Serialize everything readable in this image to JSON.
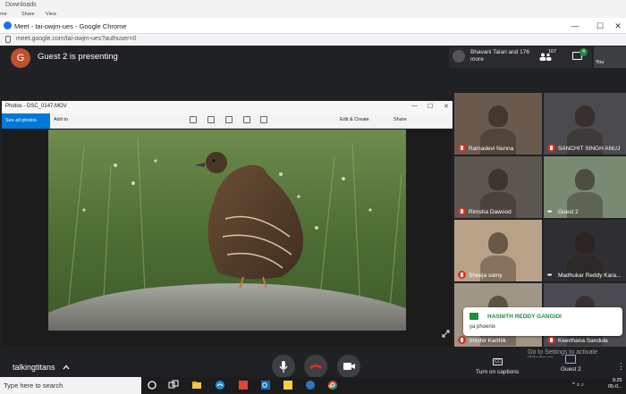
{
  "explorer": {
    "title": "Downloads",
    "menu": [
      "me",
      "Share",
      "View"
    ]
  },
  "browser": {
    "tab_title": "Meet - tai-owjm-ues - Google Chrome",
    "url": "meet.google.com/tai-owjm-ues?authuser=0",
    "win_buttons": [
      "—",
      "☐",
      "✕"
    ]
  },
  "meet": {
    "presenter_initial": "G",
    "presenting_text": "Guest 2 is presenting",
    "participants_summary": "Bhavani Talari and 176 more",
    "people_count": "107",
    "chat_badge": "4",
    "self_label": "You",
    "meeting_name": "talkingtitans",
    "captions_label": "Turn on captions",
    "presenter_label": "Guest 2",
    "activate_windows": "Go to Settings to activate Windows."
  },
  "photos": {
    "window_title": "Photos - DSC_0147.MOV",
    "see_all": "See all photos",
    "add_to": "Add to",
    "edit_create": "Edit & Create",
    "share": "Share",
    "title_buttons": [
      "—",
      "☐",
      "✕"
    ]
  },
  "tiles": [
    {
      "name": "Ramadevi Nunna",
      "status": "muted",
      "bg": "#6a5a4e"
    },
    {
      "name": "SANCHIT SINGH ANUJ",
      "status": "muted",
      "bg": "#4b4a4e"
    },
    {
      "name": "Rimsha Dawood",
      "status": "muted",
      "bg": "#5c5650"
    },
    {
      "name": "Guest 2",
      "status": "more",
      "bg": "#7a8a72"
    },
    {
      "name": "Sheeja samy",
      "status": "muted",
      "bg": "#b9a187"
    },
    {
      "name": "Madhukar Reddy Kara...",
      "status": "more",
      "bg": "#2f2f33"
    },
    {
      "name": "Shishir Karthik",
      "status": "muted",
      "bg": "#a09686"
    },
    {
      "name": "Keerthana Sandula",
      "status": "muted",
      "bg": "#4a4a50"
    }
  ],
  "chat_notification": {
    "sender": "HASNITH REDDY GANGIDI",
    "message": "ya phoenix"
  },
  "taskbar": {
    "search_placeholder": "Type here to search",
    "time": "9:25",
    "date": "05-0..."
  },
  "colors": {
    "meet_bg": "#202124",
    "end_call_red": "#d93025",
    "muted_red": "#d93025",
    "accent_green": "#1e8e3e",
    "photos_blue": "#0078d7"
  },
  "icons": [
    "meet-logo-icon",
    "people-icon",
    "chat-icon",
    "mic-icon",
    "end-call-icon",
    "camera-icon",
    "captions-icon",
    "present-icon",
    "more-vert-icon",
    "expand-icon",
    "lock-icon",
    "windows-icon",
    "task-view-icon",
    "edge-icon",
    "explorer-icon",
    "outlook-icon",
    "chrome-icon"
  ]
}
